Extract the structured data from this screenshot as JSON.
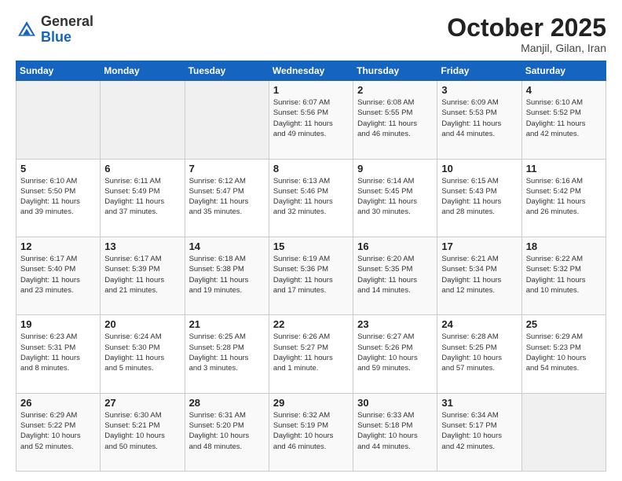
{
  "header": {
    "logo_general": "General",
    "logo_blue": "Blue",
    "month": "October 2025",
    "location": "Manjil, Gilan, Iran"
  },
  "weekdays": [
    "Sunday",
    "Monday",
    "Tuesday",
    "Wednesday",
    "Thursday",
    "Friday",
    "Saturday"
  ],
  "weeks": [
    [
      {
        "day": "",
        "info": ""
      },
      {
        "day": "",
        "info": ""
      },
      {
        "day": "",
        "info": ""
      },
      {
        "day": "1",
        "info": "Sunrise: 6:07 AM\nSunset: 5:56 PM\nDaylight: 11 hours\nand 49 minutes."
      },
      {
        "day": "2",
        "info": "Sunrise: 6:08 AM\nSunset: 5:55 PM\nDaylight: 11 hours\nand 46 minutes."
      },
      {
        "day": "3",
        "info": "Sunrise: 6:09 AM\nSunset: 5:53 PM\nDaylight: 11 hours\nand 44 minutes."
      },
      {
        "day": "4",
        "info": "Sunrise: 6:10 AM\nSunset: 5:52 PM\nDaylight: 11 hours\nand 42 minutes."
      }
    ],
    [
      {
        "day": "5",
        "info": "Sunrise: 6:10 AM\nSunset: 5:50 PM\nDaylight: 11 hours\nand 39 minutes."
      },
      {
        "day": "6",
        "info": "Sunrise: 6:11 AM\nSunset: 5:49 PM\nDaylight: 11 hours\nand 37 minutes."
      },
      {
        "day": "7",
        "info": "Sunrise: 6:12 AM\nSunset: 5:47 PM\nDaylight: 11 hours\nand 35 minutes."
      },
      {
        "day": "8",
        "info": "Sunrise: 6:13 AM\nSunset: 5:46 PM\nDaylight: 11 hours\nand 32 minutes."
      },
      {
        "day": "9",
        "info": "Sunrise: 6:14 AM\nSunset: 5:45 PM\nDaylight: 11 hours\nand 30 minutes."
      },
      {
        "day": "10",
        "info": "Sunrise: 6:15 AM\nSunset: 5:43 PM\nDaylight: 11 hours\nand 28 minutes."
      },
      {
        "day": "11",
        "info": "Sunrise: 6:16 AM\nSunset: 5:42 PM\nDaylight: 11 hours\nand 26 minutes."
      }
    ],
    [
      {
        "day": "12",
        "info": "Sunrise: 6:17 AM\nSunset: 5:40 PM\nDaylight: 11 hours\nand 23 minutes."
      },
      {
        "day": "13",
        "info": "Sunrise: 6:17 AM\nSunset: 5:39 PM\nDaylight: 11 hours\nand 21 minutes."
      },
      {
        "day": "14",
        "info": "Sunrise: 6:18 AM\nSunset: 5:38 PM\nDaylight: 11 hours\nand 19 minutes."
      },
      {
        "day": "15",
        "info": "Sunrise: 6:19 AM\nSunset: 5:36 PM\nDaylight: 11 hours\nand 17 minutes."
      },
      {
        "day": "16",
        "info": "Sunrise: 6:20 AM\nSunset: 5:35 PM\nDaylight: 11 hours\nand 14 minutes."
      },
      {
        "day": "17",
        "info": "Sunrise: 6:21 AM\nSunset: 5:34 PM\nDaylight: 11 hours\nand 12 minutes."
      },
      {
        "day": "18",
        "info": "Sunrise: 6:22 AM\nSunset: 5:32 PM\nDaylight: 11 hours\nand 10 minutes."
      }
    ],
    [
      {
        "day": "19",
        "info": "Sunrise: 6:23 AM\nSunset: 5:31 PM\nDaylight: 11 hours\nand 8 minutes."
      },
      {
        "day": "20",
        "info": "Sunrise: 6:24 AM\nSunset: 5:30 PM\nDaylight: 11 hours\nand 5 minutes."
      },
      {
        "day": "21",
        "info": "Sunrise: 6:25 AM\nSunset: 5:28 PM\nDaylight: 11 hours\nand 3 minutes."
      },
      {
        "day": "22",
        "info": "Sunrise: 6:26 AM\nSunset: 5:27 PM\nDaylight: 11 hours\nand 1 minute."
      },
      {
        "day": "23",
        "info": "Sunrise: 6:27 AM\nSunset: 5:26 PM\nDaylight: 10 hours\nand 59 minutes."
      },
      {
        "day": "24",
        "info": "Sunrise: 6:28 AM\nSunset: 5:25 PM\nDaylight: 10 hours\nand 57 minutes."
      },
      {
        "day": "25",
        "info": "Sunrise: 6:29 AM\nSunset: 5:23 PM\nDaylight: 10 hours\nand 54 minutes."
      }
    ],
    [
      {
        "day": "26",
        "info": "Sunrise: 6:29 AM\nSunset: 5:22 PM\nDaylight: 10 hours\nand 52 minutes."
      },
      {
        "day": "27",
        "info": "Sunrise: 6:30 AM\nSunset: 5:21 PM\nDaylight: 10 hours\nand 50 minutes."
      },
      {
        "day": "28",
        "info": "Sunrise: 6:31 AM\nSunset: 5:20 PM\nDaylight: 10 hours\nand 48 minutes."
      },
      {
        "day": "29",
        "info": "Sunrise: 6:32 AM\nSunset: 5:19 PM\nDaylight: 10 hours\nand 46 minutes."
      },
      {
        "day": "30",
        "info": "Sunrise: 6:33 AM\nSunset: 5:18 PM\nDaylight: 10 hours\nand 44 minutes."
      },
      {
        "day": "31",
        "info": "Sunrise: 6:34 AM\nSunset: 5:17 PM\nDaylight: 10 hours\nand 42 minutes."
      },
      {
        "day": "",
        "info": ""
      }
    ]
  ]
}
